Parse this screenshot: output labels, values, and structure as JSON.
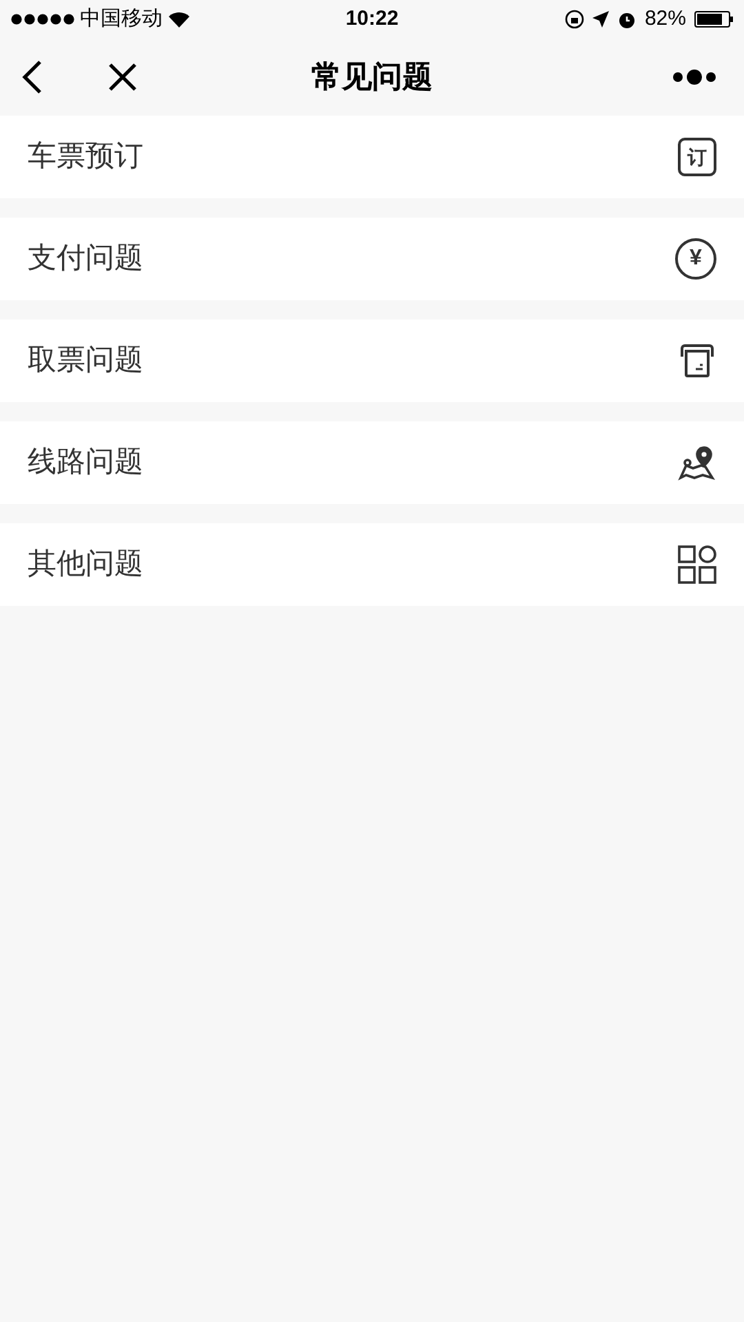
{
  "status_bar": {
    "carrier": "中国移动",
    "time": "10:22",
    "battery": "82%"
  },
  "nav": {
    "title": "常见问题"
  },
  "items": [
    {
      "label": "车票预订",
      "kind": "booking",
      "icon_text": "订"
    },
    {
      "label": "支付问题",
      "kind": "payment",
      "icon_text": "¥"
    },
    {
      "label": "取票问题",
      "kind": "ticket"
    },
    {
      "label": "线路问题",
      "kind": "route"
    },
    {
      "label": "其他问题",
      "kind": "other"
    }
  ]
}
